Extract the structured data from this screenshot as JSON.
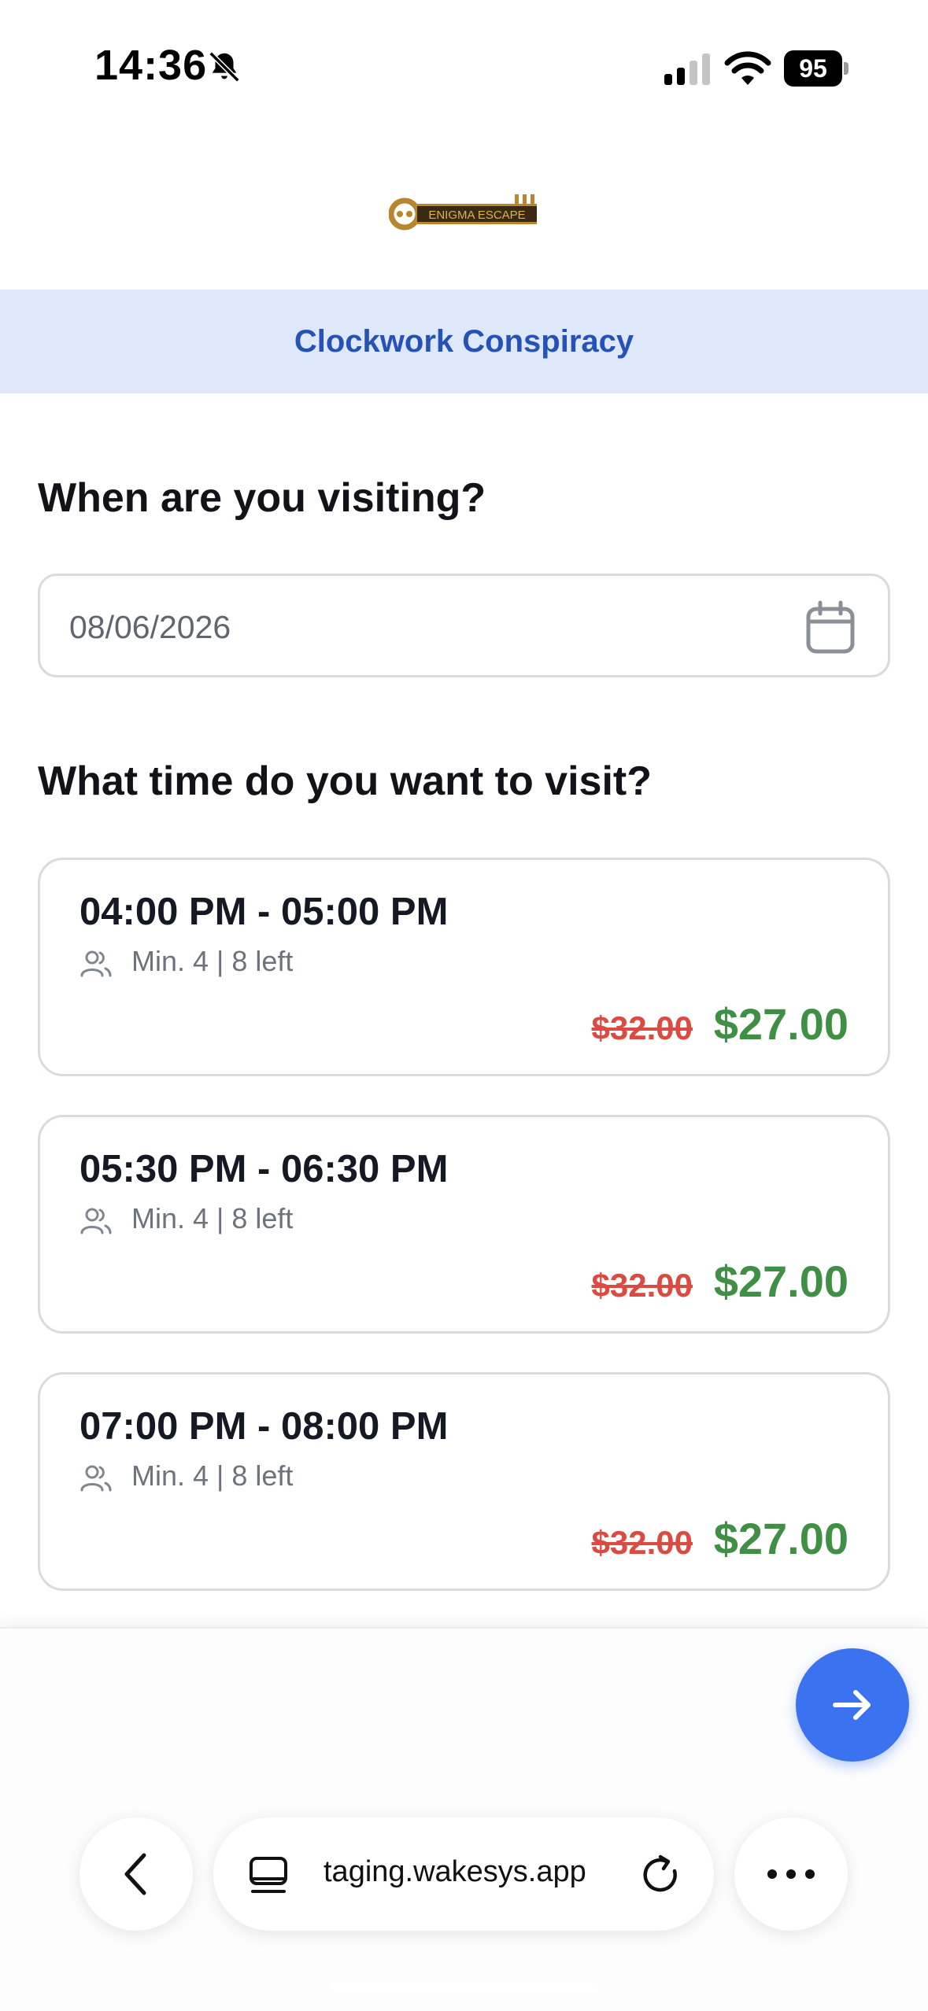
{
  "status_bar": {
    "time": "14:36",
    "battery": "95",
    "icons": [
      "bell-slash-icon",
      "cellular-signal-icon",
      "wifi-icon",
      "battery-icon"
    ]
  },
  "brand": {
    "logo_text": "ENIGMA ESCAPE",
    "colors": {
      "gold": "#b8862f",
      "dark": "#3a2a14"
    }
  },
  "room": {
    "title": "Clockwork Conspiracy"
  },
  "date_section": {
    "heading": "When are you visiting?",
    "date_value": "08/06/2026",
    "icon": "calendar-icon"
  },
  "time_section": {
    "heading": "What time do you want to visit?",
    "slots": [
      {
        "time": "04:00 PM - 05:00 PM",
        "meta": "Min. 4 | 8 left",
        "old_price": "$32.00",
        "price": "$27.00"
      },
      {
        "time": "05:30 PM - 06:30 PM",
        "meta": "Min. 4 | 8 left",
        "old_price": "$32.00",
        "price": "$27.00"
      },
      {
        "time": "07:00 PM - 08:00 PM",
        "meta": "Min. 4 | 8 left",
        "old_price": "$32.00",
        "price": "$27.00"
      }
    ]
  },
  "actions": {
    "next_icon": "arrow-right-icon"
  },
  "browser": {
    "url": "taging.wakesys.app",
    "icons": [
      "back-chevron-icon",
      "tabs-icon",
      "reload-icon",
      "more-icon"
    ]
  },
  "colors": {
    "accent_blue": "#3a72ef",
    "banner_bg": "#dfe8fb",
    "banner_text": "#2453b8",
    "price_green": "#3f8f45",
    "strike_red": "#dc4b42"
  }
}
